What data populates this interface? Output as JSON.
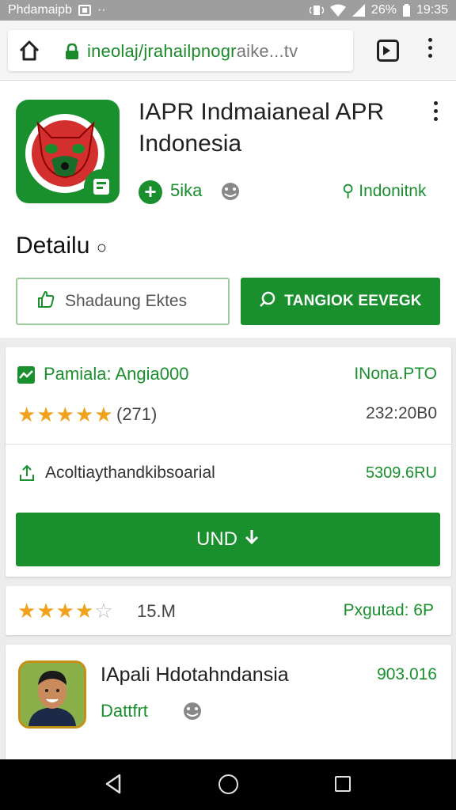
{
  "status_bar": {
    "carrier": "Phdamaipb",
    "dots": "··",
    "battery": "26%",
    "time": "19:35"
  },
  "browser": {
    "url_main": "ineolaj/jrahailpnogr",
    "url_dim": "aike...tv"
  },
  "app": {
    "title_line1": "IAPR Indmaianeal APR",
    "title_line2": "Indonesia",
    "developer": "5ika",
    "region": "Indonitnk",
    "section_title": "Detailu",
    "section_suffix": "○",
    "btn_outline_label": "Shadaung Ektes",
    "btn_filled_label": "TANGIOK EEVEGK"
  },
  "card1": {
    "name": "Pamiala: Angia000",
    "right1": "INona.PTO",
    "rating": 5,
    "rating_count": "(271)",
    "right2": "232:20B0",
    "activity_label": "Acoltiaythandkibsoarial",
    "activity_value": "5309.6RU",
    "install_label": "UND"
  },
  "card2": {
    "rating": 4,
    "count": "15.M",
    "right": "Pxgutad: 6P"
  },
  "card3": {
    "title": "IApali Hdotahndansia",
    "right": "903.016",
    "sub": "Dattfrt"
  },
  "colors": {
    "accent": "#1a8f2e",
    "star": "#f0a21b"
  },
  "icons": [
    "home-icon",
    "lock-icon",
    "tab-icon",
    "menu-icon",
    "plus-icon",
    "emoji-icon",
    "flag-icon",
    "thumb-icon",
    "search-icon",
    "chart-icon",
    "share-icon",
    "download-icon",
    "star-icon",
    "back-icon",
    "circle-home-icon",
    "recent-icon"
  ]
}
